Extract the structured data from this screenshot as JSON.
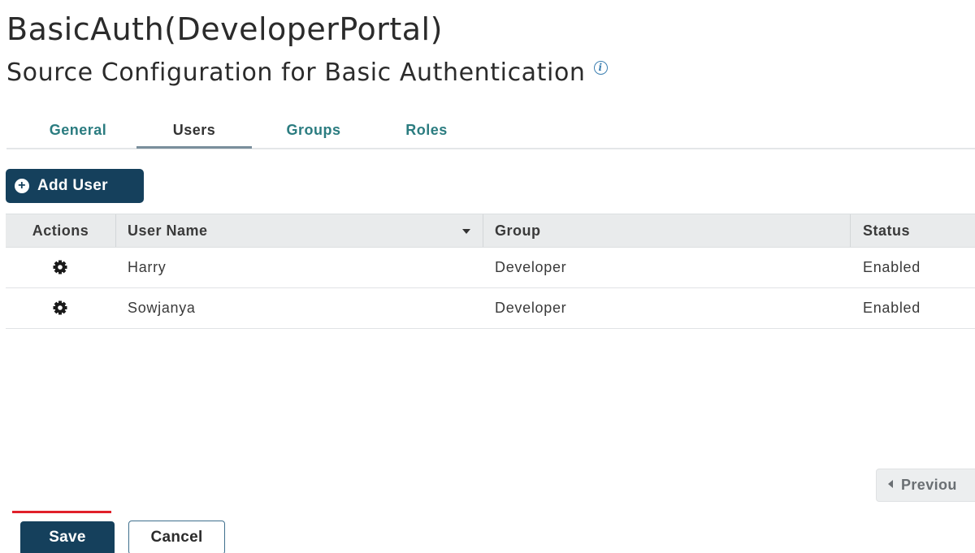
{
  "header": {
    "title": "BasicAuth(DeveloperPortal)",
    "subtitle": "Source Configuration for Basic Authentication",
    "info_icon": "info-icon",
    "info_glyph": "i"
  },
  "tabs": [
    {
      "label": "General",
      "active": false
    },
    {
      "label": "Users",
      "active": true
    },
    {
      "label": "Groups",
      "active": false
    },
    {
      "label": "Roles",
      "active": false
    }
  ],
  "toolbar": {
    "add_user_label": "Add User",
    "add_user_icon": "plus-circle-icon"
  },
  "table": {
    "columns": [
      "Actions",
      "User Name",
      "Group",
      "Status"
    ],
    "sorted_column": "User Name",
    "rows": [
      {
        "action_icon": "gear-icon",
        "user_name": "Harry",
        "group": "Developer",
        "status": "Enabled"
      },
      {
        "action_icon": "gear-icon",
        "user_name": "Sowjanya",
        "group": "Developer",
        "status": "Enabled"
      }
    ]
  },
  "pager": {
    "previous_label": "Previou"
  },
  "footer": {
    "save_label": "Save",
    "cancel_label": "Cancel"
  },
  "colors": {
    "primary": "#15405c",
    "tab_link": "#2b7c80",
    "marker": "#e0202a"
  }
}
